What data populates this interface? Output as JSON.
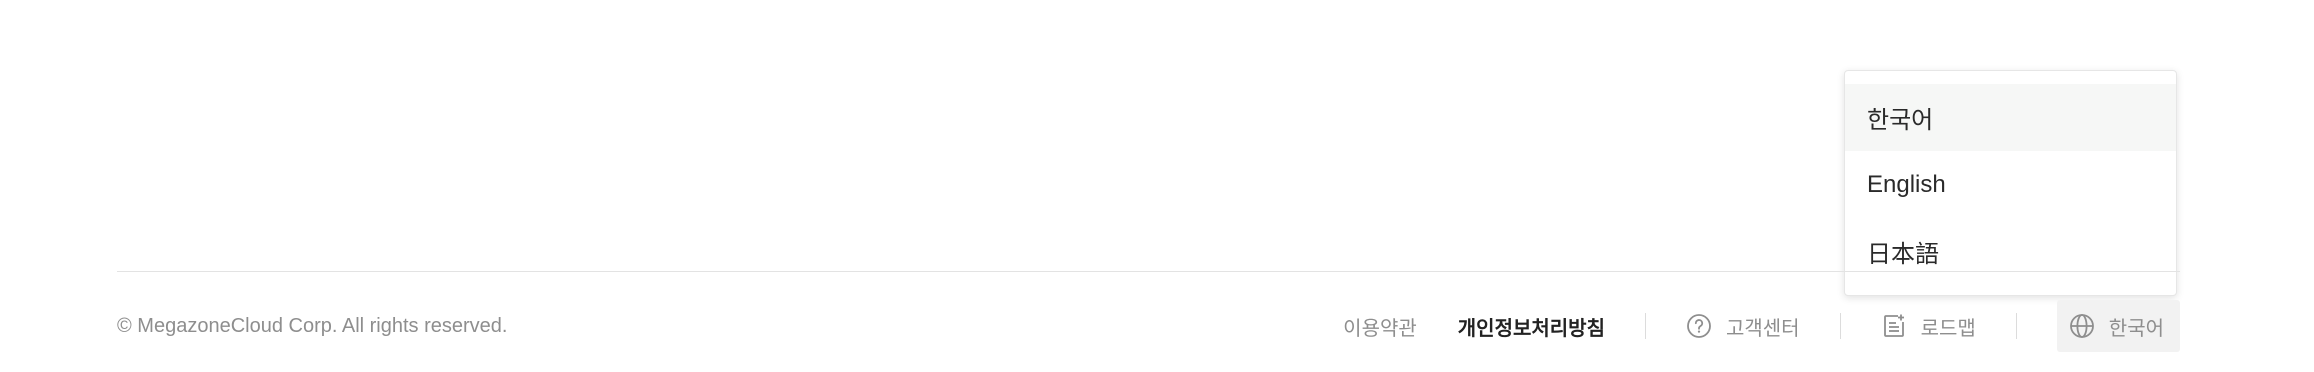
{
  "footer": {
    "copyright": "© MegazoneCloud Corp. All rights reserved.",
    "links": {
      "terms": "이용약관",
      "privacy": "개인정보처리방침",
      "support": "고객센터",
      "roadmap": "로드맵"
    },
    "language_button": {
      "label": "한국어",
      "icon": "globe-icon"
    },
    "icons": {
      "support": "help-circle-icon",
      "roadmap": "roadmap-icon"
    }
  },
  "language_menu": {
    "selected": "한국어",
    "options": [
      "한국어",
      "English",
      "日本語"
    ]
  },
  "colors": {
    "muted_text": "#8e8e8e",
    "strong_text": "#222222",
    "selected_option_bg": "#f6f7f6",
    "language_button_bg": "#f2f2f2"
  }
}
